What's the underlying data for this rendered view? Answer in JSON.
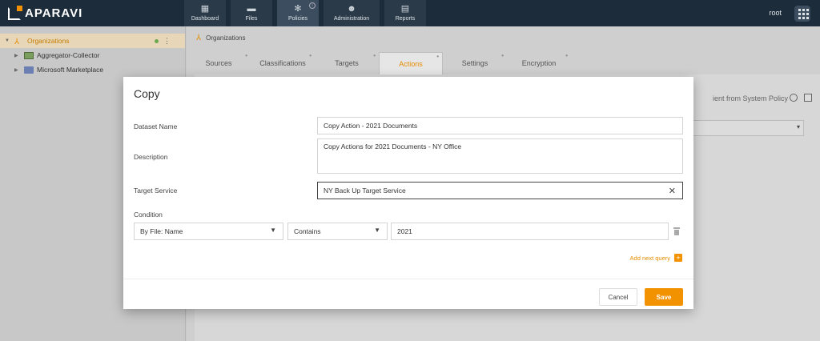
{
  "app": {
    "logo_text": "APARAVI"
  },
  "nav": [
    {
      "label": "Dashboard",
      "icon": "dashboard-icon"
    },
    {
      "label": "Files",
      "icon": "folder-icon"
    },
    {
      "label": "Policies",
      "icon": "gear-icon"
    },
    {
      "label": "Administration",
      "icon": "users-icon"
    },
    {
      "label": "Reports",
      "icon": "report-icon"
    }
  ],
  "user": {
    "name": "root"
  },
  "sidebar": {
    "items": [
      {
        "label": "Organizations",
        "icon": "organization-icon"
      },
      {
        "label": "Aggregator-Collector",
        "icon": "aggregator-icon"
      },
      {
        "label": "Microsoft Marketplace",
        "icon": "folder-icon"
      }
    ]
  },
  "breadcrumb": {
    "label": "Organizations"
  },
  "tabs": [
    "Sources",
    "Classifications",
    "Targets",
    "Actions",
    "Settings",
    "Encryption"
  ],
  "background": {
    "inherit_text": "ient from System Policy"
  },
  "modal": {
    "title": "Copy",
    "dataset_name_label": "Dataset Name",
    "dataset_name_value": "Copy Action - 2021 Documents",
    "description_label": "Description",
    "description_value": "Copy Actions for 2021 Documents - NY Office",
    "target_service_label": "Target Service",
    "target_service_value": "NY Back Up Target Service",
    "condition_label": "Condition",
    "condition_field": "By File: Name",
    "condition_operator": "Contains",
    "condition_value": "2021",
    "add_query_label": "Add next query",
    "cancel_label": "Cancel",
    "save_label": "Save"
  },
  "colors": {
    "accent": "#f39200",
    "topbar": "#1d2c3a"
  }
}
